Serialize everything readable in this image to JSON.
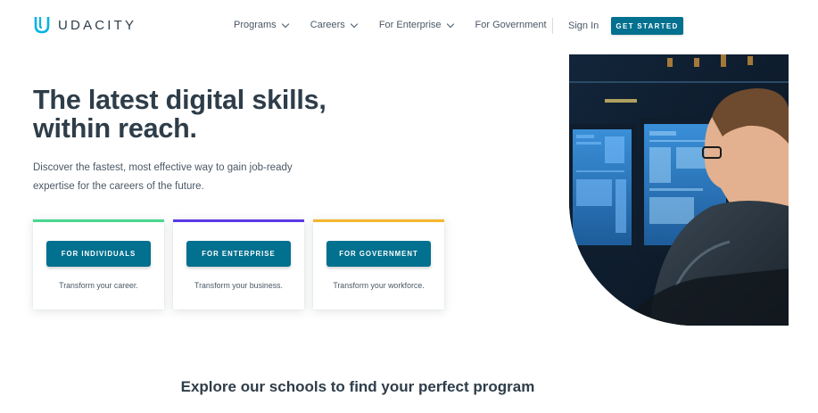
{
  "brand": {
    "name": "UDACITY",
    "logo_icon": "udacity-u-logo-icon"
  },
  "nav": {
    "items": [
      {
        "label": "Programs",
        "has_dropdown": true
      },
      {
        "label": "Careers",
        "has_dropdown": true
      },
      {
        "label": "For Enterprise",
        "has_dropdown": true
      },
      {
        "label": "For Government",
        "has_dropdown": false
      }
    ],
    "sign_in": "Sign In",
    "cta": "GET STARTED"
  },
  "hero": {
    "title": "The latest digital skills, within reach.",
    "subtitle": "Discover the fastest, most effective way to gain job-ready expertise for the careers of the future.",
    "image_alt_icon": "person-at-monitors-photo"
  },
  "cards": [
    {
      "button": "FOR INDIVIDUALS",
      "text": "Transform your career.",
      "accent": "#49d890"
    },
    {
      "button": "FOR ENTERPRISE",
      "text": "Transform your business.",
      "accent": "#5a3be5"
    },
    {
      "button": "FOR GOVERNMENT",
      "text": "Transform your workforce.",
      "accent": "#f6b62e"
    }
  ],
  "explore": {
    "heading": "Explore our schools to find your perfect program"
  },
  "colors": {
    "primary": "#02708f",
    "text": "#2e3d49",
    "muted": "#4a5866"
  }
}
